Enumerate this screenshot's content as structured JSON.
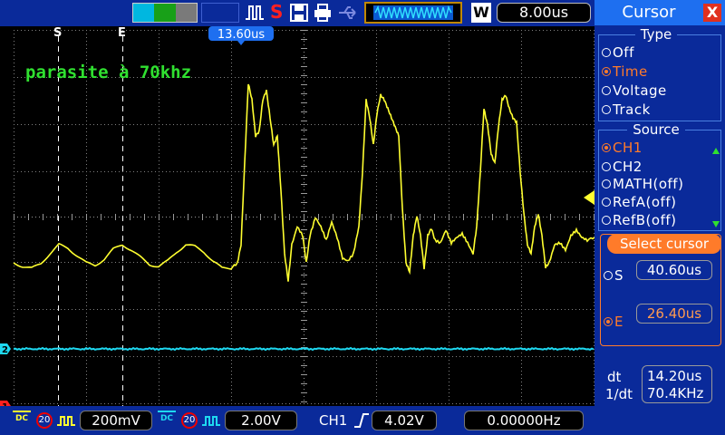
{
  "topbar": {
    "stop_letter": "S",
    "w_label": "W",
    "timebase": "8.00us",
    "logo_colors": [
      "#00b7e0",
      "#18a018",
      "#7a7a7a"
    ]
  },
  "screen": {
    "annotation": "parasite à 70khz",
    "cursor_delta_label": "13.60us",
    "cursor_s_label": "S",
    "cursor_e_label": "E",
    "ch2_marker": "2",
    "ch1_marker": "1",
    "colors": {
      "ch1": "#ffff30",
      "ch2": "#1ed8f0",
      "annotation": "#30e030",
      "grid": "#808080"
    }
  },
  "bottombar": {
    "ch1_coupling": "DC",
    "ch1_bw": "20",
    "ch1_volts": "200mV",
    "ch2_coupling": "DC",
    "ch2_bw": "20",
    "ch2_volts": "2.00V",
    "trigger_source": "CH1",
    "trigger_level": "4.02V",
    "frequency": "0.00000Hz"
  },
  "panel": {
    "title": "Cursor",
    "close_glyph": "X",
    "type_title": "Type",
    "type_options": [
      {
        "label": "Off",
        "selected": false
      },
      {
        "label": "Time",
        "selected": true
      },
      {
        "label": "Voltage",
        "selected": false
      },
      {
        "label": "Track",
        "selected": false
      }
    ],
    "source_title": "Source",
    "source_options": [
      {
        "label": "CH1",
        "selected": true
      },
      {
        "label": "CH2",
        "selected": false
      },
      {
        "label": "MATH(off)",
        "selected": false
      },
      {
        "label": "RefA(off)",
        "selected": false
      },
      {
        "label": "RefB(off)",
        "selected": false
      }
    ],
    "select_title": "Select cursor",
    "s_label": "S",
    "s_value": "40.60us",
    "e_label": "E",
    "e_value": "26.40us",
    "dt_label": "dt",
    "dt_value": "14.20us",
    "inv_dt_label": "1/dt",
    "inv_dt_value": "70.4KHz"
  }
}
